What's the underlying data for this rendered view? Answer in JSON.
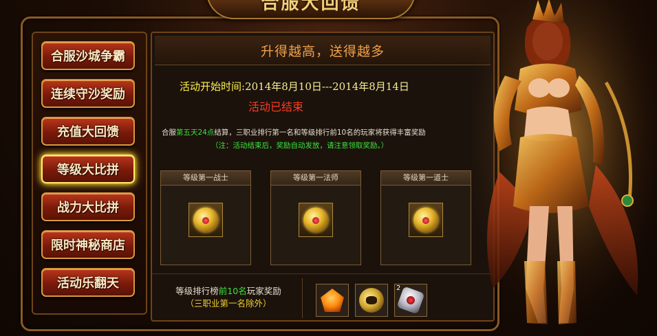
{
  "banner": {
    "title": "合服大回馈"
  },
  "sidebar": {
    "items": [
      {
        "label": "合服沙城争霸",
        "active": false
      },
      {
        "label": "连续守沙奖励",
        "active": false
      },
      {
        "label": "充值大回馈",
        "active": false
      },
      {
        "label": "等级大比拼",
        "active": true
      },
      {
        "label": "战力大比拼",
        "active": false
      },
      {
        "label": "限时神秘商店",
        "active": false
      },
      {
        "label": "活动乐翻天",
        "active": false
      }
    ]
  },
  "main": {
    "slogan": "升得越高，送得越多",
    "time_label": "活动开始时间:",
    "time_value": "2014年8月10日---2014年8月14日",
    "status": "活动已结束",
    "desc_prefix": "合服",
    "desc_highlight": "第五天24点",
    "desc_suffix": "结算，三职业排行第一名和等级排行前10名的玩家将获得丰富奖励",
    "note": "（注：活动结束后，奖励自动发放，请注意领取奖励。）",
    "cards": [
      {
        "title": "等级第一战士"
      },
      {
        "title": "等级第一法师"
      },
      {
        "title": "等级第一道士"
      }
    ],
    "bottom": {
      "text_prefix": "等级排行榜",
      "text_highlight": "前10名",
      "text_suffix": "玩家奖励",
      "sub": "（三职业第一名除外）",
      "stone_count": "2"
    }
  }
}
